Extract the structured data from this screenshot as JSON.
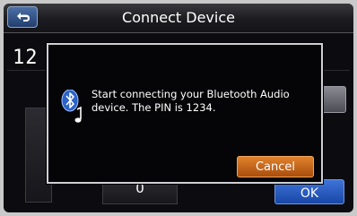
{
  "header": {
    "title": "Connect Device",
    "back_icon": "back-arrow-icon"
  },
  "background": {
    "number_entry": "12",
    "key_zero": "0",
    "ok_label": "OK"
  },
  "dialog": {
    "icon": "bluetooth-audio-icon",
    "message": "Start connecting your Bluetooth Audio device.  The PIN is 1234.",
    "cancel_label": "Cancel"
  },
  "colors": {
    "accent_blue": "#2a5bc0",
    "cancel_orange": "#c8641c"
  }
}
